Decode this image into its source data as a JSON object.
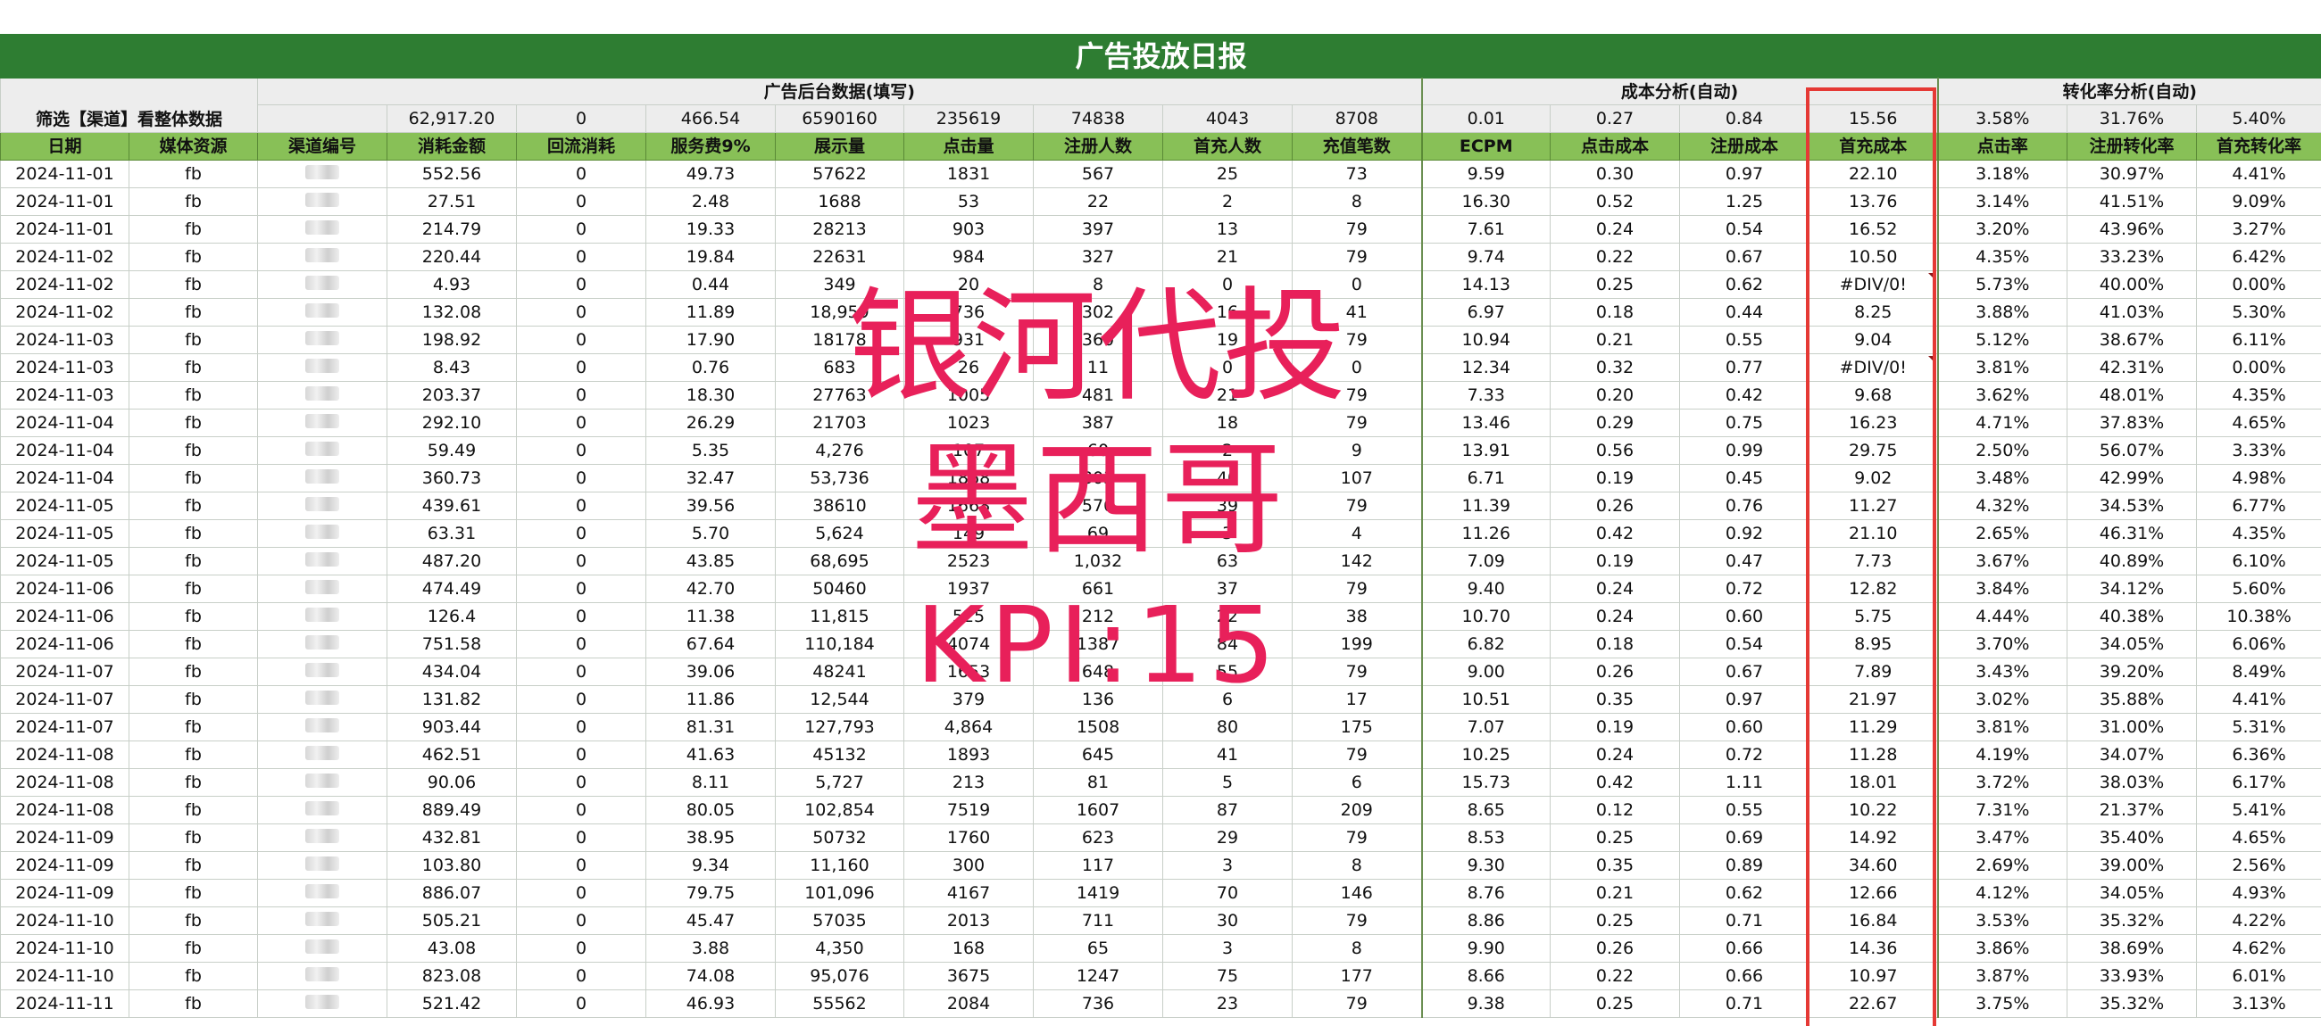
{
  "title": "广告投放日报",
  "filter_label": "筛选【渠道】看整体数据",
  "groups": {
    "ad_backend": "广告后台数据(填写)",
    "cost_analysis": "成本分析(自动)",
    "conversion_analysis": "转化率分析(自动)"
  },
  "totals": [
    "62,917.20",
    "0",
    "466.54",
    "6590160",
    "235619",
    "74838",
    "4043",
    "8708",
    "0.01",
    "0.27",
    "0.84",
    "15.56",
    "3.58%",
    "31.76%",
    "5.40%"
  ],
  "headers": [
    "日期",
    "媒体资源",
    "渠道编号",
    "消耗金额",
    "回流消耗",
    "服务费9%",
    "展示量",
    "点击量",
    "注册人数",
    "首充人数",
    "充值笔数",
    "ECPM",
    "点击成本",
    "注册成本",
    "首充成本",
    "点击率",
    "注册转化率",
    "首充转化率"
  ],
  "rows": [
    [
      "2024-11-01",
      "fb",
      "552.56",
      "0",
      "49.73",
      "57622",
      "1831",
      "567",
      "25",
      "73",
      "9.59",
      "0.30",
      "0.97",
      "22.10",
      "3.18%",
      "30.97%",
      "4.41%"
    ],
    [
      "2024-11-01",
      "fb",
      "27.51",
      "0",
      "2.48",
      "1688",
      "53",
      "22",
      "2",
      "8",
      "16.30",
      "0.52",
      "1.25",
      "13.76",
      "3.14%",
      "41.51%",
      "9.09%"
    ],
    [
      "2024-11-01",
      "fb",
      "214.79",
      "0",
      "19.33",
      "28213",
      "903",
      "397",
      "13",
      "79",
      "7.61",
      "0.24",
      "0.54",
      "16.52",
      "3.20%",
      "43.96%",
      "3.27%"
    ],
    [
      "2024-11-02",
      "fb",
      "220.44",
      "0",
      "19.84",
      "22631",
      "984",
      "327",
      "21",
      "79",
      "9.74",
      "0.22",
      "0.67",
      "10.50",
      "4.35%",
      "33.23%",
      "6.42%"
    ],
    [
      "2024-11-02",
      "fb",
      "4.93",
      "0",
      "0.44",
      "349",
      "20",
      "8",
      "0",
      "0",
      "14.13",
      "0.25",
      "0.62",
      "#DIV/0!",
      "5.73%",
      "40.00%",
      "0.00%"
    ],
    [
      "2024-11-02",
      "fb",
      "132.08",
      "0",
      "11.89",
      "18,959",
      "736",
      "302",
      "16",
      "41",
      "6.97",
      "0.18",
      "0.44",
      "8.25",
      "3.88%",
      "41.03%",
      "5.30%"
    ],
    [
      "2024-11-03",
      "fb",
      "198.92",
      "0",
      "17.90",
      "18178",
      "931",
      "360",
      "19",
      "79",
      "10.94",
      "0.21",
      "0.55",
      "9.04",
      "5.12%",
      "38.67%",
      "6.11%"
    ],
    [
      "2024-11-03",
      "fb",
      "8.43",
      "0",
      "0.76",
      "683",
      "26",
      "11",
      "0",
      "0",
      "12.34",
      "0.32",
      "0.77",
      "#DIV/0!",
      "3.81%",
      "42.31%",
      "0.00%"
    ],
    [
      "2024-11-03",
      "fb",
      "203.37",
      "0",
      "18.30",
      "27763",
      "1005",
      "481",
      "21",
      "79",
      "7.33",
      "0.20",
      "0.42",
      "9.68",
      "3.62%",
      "48.01%",
      "4.35%"
    ],
    [
      "2024-11-04",
      "fb",
      "292.10",
      "0",
      "26.29",
      "21703",
      "1023",
      "387",
      "18",
      "79",
      "13.46",
      "0.29",
      "0.75",
      "16.23",
      "4.71%",
      "37.83%",
      "4.65%"
    ],
    [
      "2024-11-04",
      "fb",
      "59.49",
      "0",
      "5.35",
      "4,276",
      "107",
      "60",
      "2",
      "9",
      "13.91",
      "0.56",
      "0.99",
      "29.75",
      "2.50%",
      "56.07%",
      "3.33%"
    ],
    [
      "2024-11-04",
      "fb",
      "360.73",
      "0",
      "32.47",
      "53,736",
      "1868",
      "803",
      "40",
      "107",
      "6.71",
      "0.19",
      "0.45",
      "9.02",
      "3.48%",
      "42.99%",
      "4.98%"
    ],
    [
      "2024-11-05",
      "fb",
      "439.61",
      "0",
      "39.56",
      "38610",
      "1668",
      "576",
      "39",
      "79",
      "11.39",
      "0.26",
      "0.76",
      "11.27",
      "4.32%",
      "34.53%",
      "6.77%"
    ],
    [
      "2024-11-05",
      "fb",
      "63.31",
      "0",
      "5.70",
      "5,624",
      "149",
      "69",
      "3",
      "4",
      "11.26",
      "0.42",
      "0.92",
      "21.10",
      "2.65%",
      "46.31%",
      "4.35%"
    ],
    [
      "2024-11-05",
      "fb",
      "487.20",
      "0",
      "43.85",
      "68,695",
      "2523",
      "1,032",
      "63",
      "142",
      "7.09",
      "0.19",
      "0.47",
      "7.73",
      "3.67%",
      "40.89%",
      "6.10%"
    ],
    [
      "2024-11-06",
      "fb",
      "474.49",
      "0",
      "42.70",
      "50460",
      "1937",
      "661",
      "37",
      "79",
      "9.40",
      "0.24",
      "0.72",
      "12.82",
      "3.84%",
      "34.12%",
      "5.60%"
    ],
    [
      "2024-11-06",
      "fb",
      "126.4",
      "0",
      "11.38",
      "11,815",
      "525",
      "212",
      "22",
      "38",
      "10.70",
      "0.24",
      "0.60",
      "5.75",
      "4.44%",
      "40.38%",
      "10.38%"
    ],
    [
      "2024-11-06",
      "fb",
      "751.58",
      "0",
      "67.64",
      "110,184",
      "4074",
      "1387",
      "84",
      "199",
      "6.82",
      "0.18",
      "0.54",
      "8.95",
      "3.70%",
      "34.05%",
      "6.06%"
    ],
    [
      "2024-11-07",
      "fb",
      "434.04",
      "0",
      "39.06",
      "48241",
      "1653",
      "648",
      "55",
      "79",
      "9.00",
      "0.26",
      "0.67",
      "7.89",
      "3.43%",
      "39.20%",
      "8.49%"
    ],
    [
      "2024-11-07",
      "fb",
      "131.82",
      "0",
      "11.86",
      "12,544",
      "379",
      "136",
      "6",
      "17",
      "10.51",
      "0.35",
      "0.97",
      "21.97",
      "3.02%",
      "35.88%",
      "4.41%"
    ],
    [
      "2024-11-07",
      "fb",
      "903.44",
      "0",
      "81.31",
      "127,793",
      "4,864",
      "1508",
      "80",
      "175",
      "7.07",
      "0.19",
      "0.60",
      "11.29",
      "3.81%",
      "31.00%",
      "5.31%"
    ],
    [
      "2024-11-08",
      "fb",
      "462.51",
      "0",
      "41.63",
      "45132",
      "1893",
      "645",
      "41",
      "79",
      "10.25",
      "0.24",
      "0.72",
      "11.28",
      "4.19%",
      "34.07%",
      "6.36%"
    ],
    [
      "2024-11-08",
      "fb",
      "90.06",
      "0",
      "8.11",
      "5,727",
      "213",
      "81",
      "5",
      "6",
      "15.73",
      "0.42",
      "1.11",
      "18.01",
      "3.72%",
      "38.03%",
      "6.17%"
    ],
    [
      "2024-11-08",
      "fb",
      "889.49",
      "0",
      "80.05",
      "102,854",
      "7519",
      "1607",
      "87",
      "209",
      "8.65",
      "0.12",
      "0.55",
      "10.22",
      "7.31%",
      "21.37%",
      "5.41%"
    ],
    [
      "2024-11-09",
      "fb",
      "432.81",
      "0",
      "38.95",
      "50732",
      "1760",
      "623",
      "29",
      "79",
      "8.53",
      "0.25",
      "0.69",
      "14.92",
      "3.47%",
      "35.40%",
      "4.65%"
    ],
    [
      "2024-11-09",
      "fb",
      "103.80",
      "0",
      "9.34",
      "11,160",
      "300",
      "117",
      "3",
      "8",
      "9.30",
      "0.35",
      "0.89",
      "34.60",
      "2.69%",
      "39.00%",
      "2.56%"
    ],
    [
      "2024-11-09",
      "fb",
      "886.07",
      "0",
      "79.75",
      "101,096",
      "4167",
      "1419",
      "70",
      "146",
      "8.76",
      "0.21",
      "0.62",
      "12.66",
      "4.12%",
      "34.05%",
      "4.93%"
    ],
    [
      "2024-11-10",
      "fb",
      "505.21",
      "0",
      "45.47",
      "57035",
      "2013",
      "711",
      "30",
      "79",
      "8.86",
      "0.25",
      "0.71",
      "16.84",
      "3.53%",
      "35.32%",
      "4.22%"
    ],
    [
      "2024-11-10",
      "fb",
      "43.08",
      "0",
      "3.88",
      "4,350",
      "168",
      "65",
      "3",
      "8",
      "9.90",
      "0.26",
      "0.66",
      "14.36",
      "3.86%",
      "38.69%",
      "4.62%"
    ],
    [
      "2024-11-10",
      "fb",
      "823.08",
      "0",
      "74.08",
      "95,076",
      "3675",
      "1247",
      "75",
      "177",
      "8.66",
      "0.22",
      "0.66",
      "10.97",
      "3.87%",
      "33.93%",
      "6.01%"
    ],
    [
      "2024-11-11",
      "fb",
      "521.42",
      "0",
      "46.93",
      "55562",
      "2084",
      "736",
      "23",
      "79",
      "9.38",
      "0.25",
      "0.71",
      "22.67",
      "3.75%",
      "35.32%",
      "3.13%"
    ]
  ],
  "watermark": {
    "line1": "银河代投",
    "line2": "墨西哥",
    "line3": "KPI:15"
  },
  "colors": {
    "title_bg": "#2e7d32",
    "header_bg": "#88c057",
    "highlight_box": "#e53935",
    "watermark": "#e8205a"
  }
}
